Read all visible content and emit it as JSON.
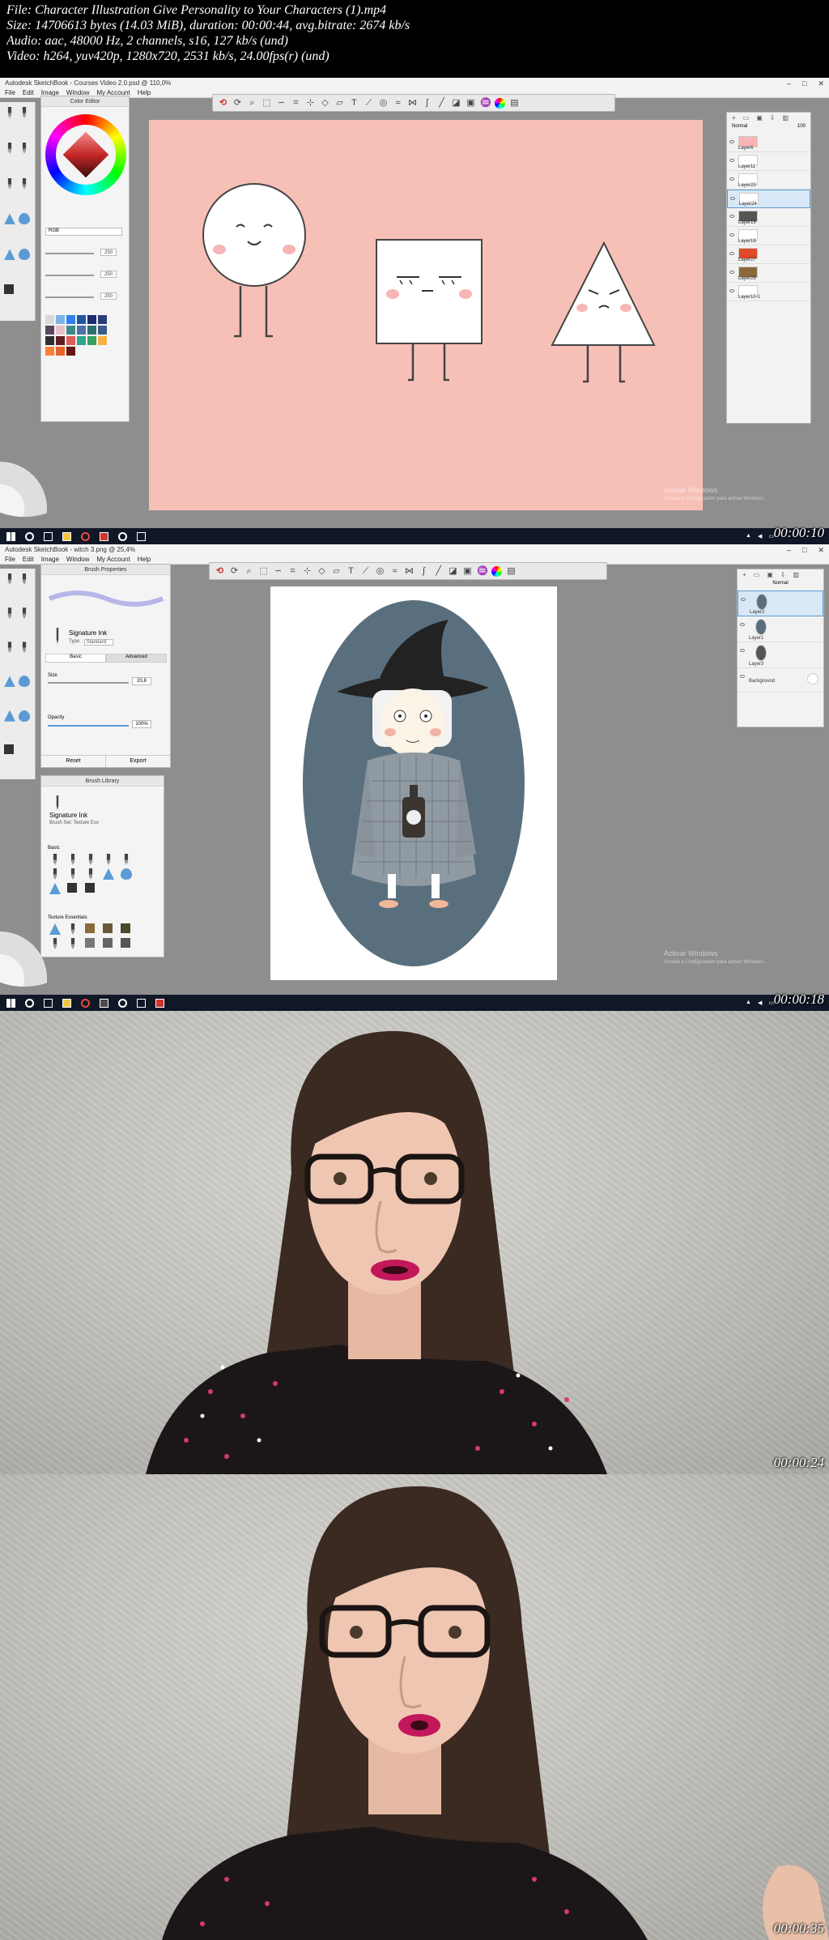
{
  "header": {
    "file": "File: Character Illustration Give Personality to Your Characters (1).mp4",
    "size": "Size: 14706613 bytes (14.03 MiB), duration: 00:00:44, avg.bitrate: 2674 kb/s",
    "audio": "Audio: aac, 48000 Hz, 2 channels, s16, 127 kb/s (und)",
    "video": "Video: h264, yuv420p, 1280x720, 2531 kb/s, 24.00fps(r) (und)"
  },
  "colors": {
    "pink_canvas": "#f7c0b7",
    "oval_blue": "#5a6f7d",
    "accent_blue": "#5b9bd5",
    "lipstick": "#c2185b"
  },
  "frame1": {
    "timestamp": "00:00:10",
    "title": "Autodesk SketchBook - Courses Video 2.0.psd @ 110,0%",
    "menu": [
      "File",
      "Edit",
      "Image",
      "Window",
      "My Account",
      "Help"
    ],
    "color_editor": {
      "title": "Color Editor",
      "mode": "RGB",
      "r": "250",
      "g": "250",
      "b": "250"
    },
    "layers": {
      "blend": "Normal",
      "opacity": "100",
      "items": [
        "Layer6",
        "Layer11",
        "Layer23",
        "Layer24",
        "Layer16",
        "Layer19",
        "Layer27",
        "Layer26",
        "Layer10-1"
      ]
    },
    "watermark": "Activar Windows",
    "watermark_sub": "Acceda a Configuración para activar Windows."
  },
  "frame2": {
    "timestamp": "00:00:18",
    "title": "Autodesk SketchBook - witch 3.png @ 25,4%",
    "menu": [
      "File",
      "Edit",
      "Image",
      "Window",
      "My Account",
      "Help"
    ],
    "brush_properties": {
      "title": "Brush Properties",
      "brush_name": "Signature Ink",
      "type_label": "Type:",
      "type_value": "Standard",
      "tab_basic": "Basic",
      "tab_advanced": "Advanced",
      "size_label": "Size",
      "size_value": "20,8",
      "opacity_label": "Opacity",
      "opacity_value": "100%",
      "reset": "Reset",
      "export": "Export"
    },
    "brush_library": {
      "title": "Brush Library",
      "brush_name": "Signature Ink",
      "brush_set": "Brush Set: Texture Ess",
      "section_basic": "Basic",
      "section_texture": "Texture Essentials"
    },
    "layers": {
      "blend": "Normal",
      "items": [
        "Layer2",
        "Layer1",
        "Layer3",
        "Background"
      ]
    },
    "watermark": "Activar Windows",
    "watermark_sub": "Acceda a Configuración para activar Windows."
  },
  "frame3": {
    "timestamp": "00:00:24"
  },
  "frame4": {
    "timestamp": "00:00:35"
  }
}
